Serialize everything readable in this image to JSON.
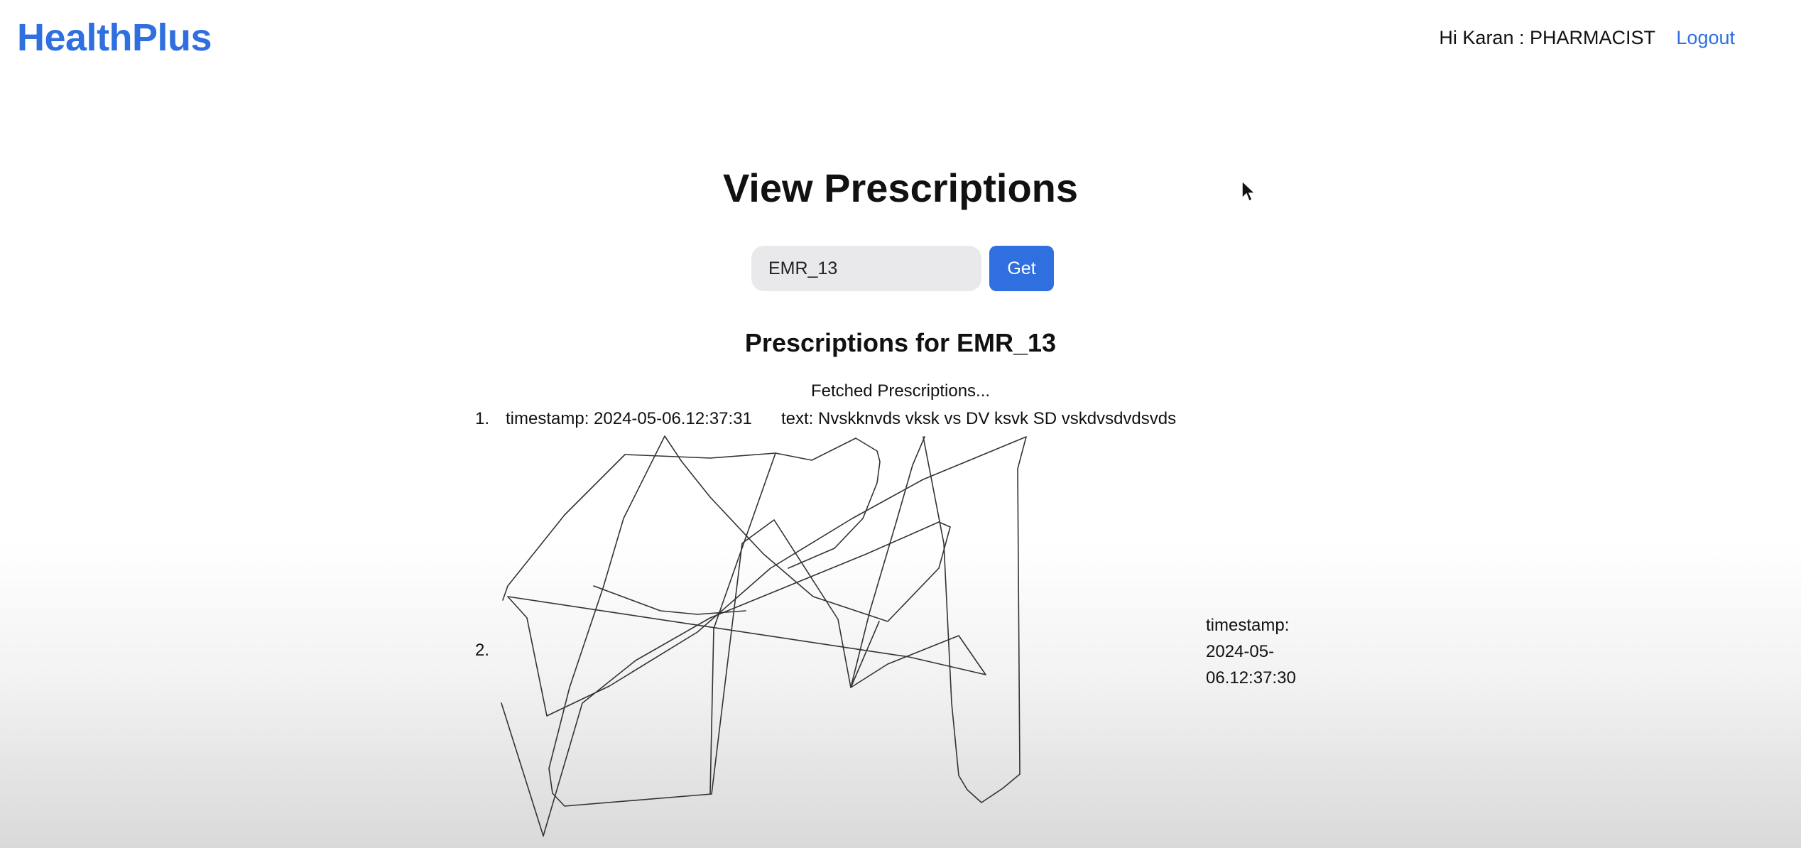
{
  "header": {
    "brand": "HealthPlus",
    "greeting": "Hi Karan : PHARMACIST",
    "logout_label": "Logout"
  },
  "main": {
    "title": "View Prescriptions",
    "search": {
      "value": "EMR_13"
    },
    "get_label": "Get",
    "section_heading": "Prescriptions for EMR_13",
    "status": "Fetched Prescriptions...",
    "prescriptions": [
      {
        "index": "1.",
        "timestamp_text": "timestamp: 2024-05-06.12:37:31",
        "body_text": "text: Nvskknvds vksk vs DV ksvk SD vskdvsdvdsvds"
      },
      {
        "index": "2.",
        "timestamp_lines": [
          "timestamp:",
          "2024-05-",
          "06.12:37:30"
        ],
        "image_icon": "handwritten-signature"
      }
    ]
  }
}
